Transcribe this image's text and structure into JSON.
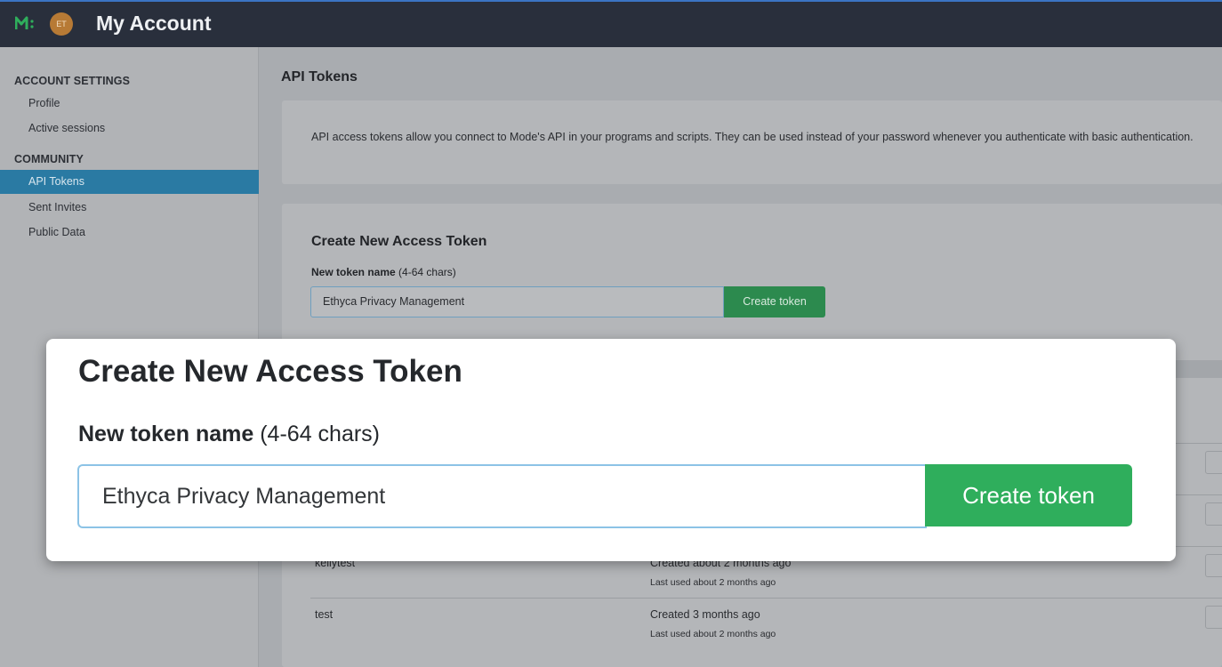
{
  "header": {
    "avatar_initials": "ET",
    "title": "My Account",
    "logo_icon": "mode-logo-icon"
  },
  "sidebar": {
    "sections": [
      {
        "label": "ACCOUNT SETTINGS",
        "items": [
          {
            "label": "Profile"
          },
          {
            "label": "Active sessions"
          }
        ]
      },
      {
        "label": "COMMUNITY",
        "items": [
          {
            "label": "API Tokens",
            "active": true
          },
          {
            "label": "Sent Invites"
          },
          {
            "label": "Public Data"
          }
        ]
      }
    ]
  },
  "main": {
    "title": "API Tokens",
    "description": "API access tokens allow you connect to Mode's API in your programs and scripts. They can be used instead of your password whenever you authenticate with basic authentication.",
    "create": {
      "title": "Create New Access Token",
      "label_bold": "New token name",
      "label_hint": "(4-64 chars)",
      "input_value": "Ethyca Privacy Management",
      "button_label": "Create token"
    },
    "tokens": [
      {
        "name": "kellytest",
        "created": "Created about 2 months ago",
        "last_used": "Last used about 2 months ago"
      },
      {
        "name": "test",
        "created": "Created 3 months ago",
        "last_used": "Last used about 2 months ago"
      }
    ]
  },
  "colors": {
    "topbar": "#292f3c",
    "active_nav": "#2a7aa3",
    "create_button": "#2fae5c",
    "input_focus_border": "#8cc3e6",
    "avatar": "#b77a35"
  }
}
